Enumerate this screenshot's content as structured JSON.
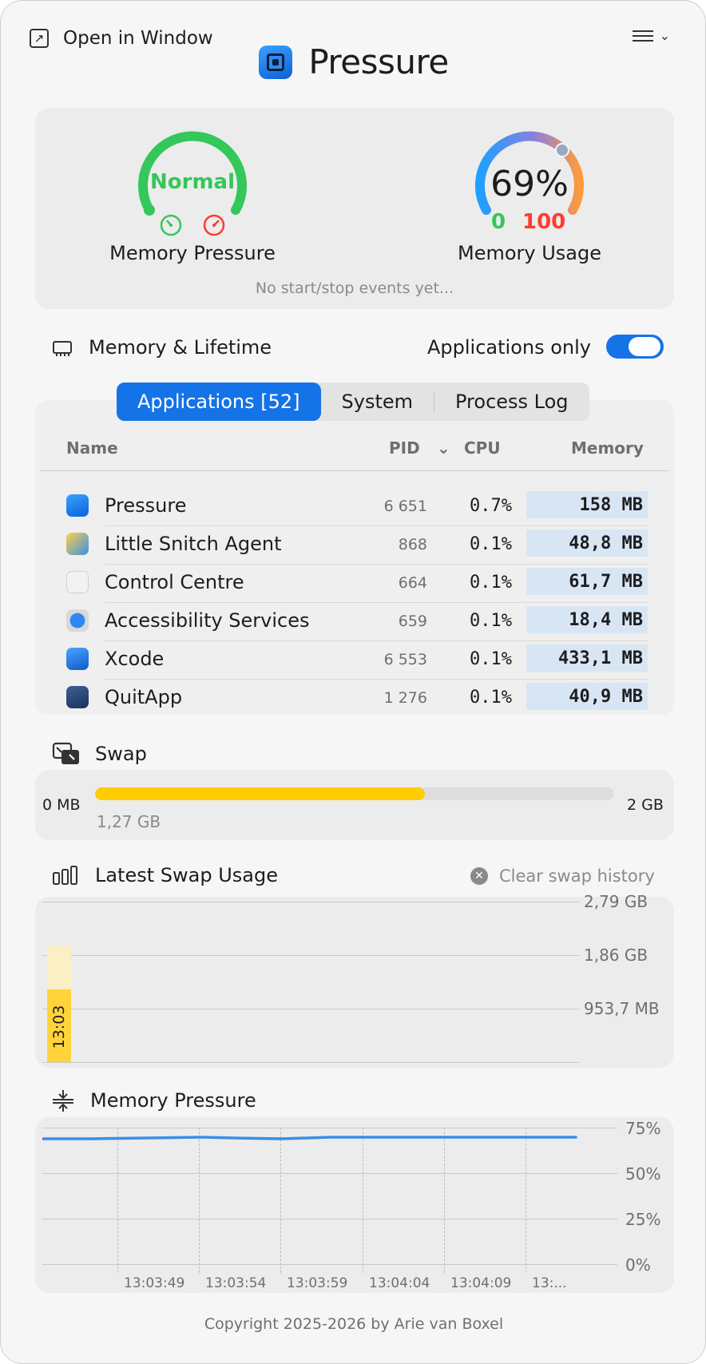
{
  "header": {
    "open_in_window": "Open in Window",
    "title": "Pressure",
    "open_icon": "arrow-up-right-square-icon",
    "menu_icon": "list-menu-icon"
  },
  "gauges": {
    "pressure": {
      "status": "Normal",
      "label": "Memory Pressure",
      "color": "#34c759"
    },
    "usage": {
      "value_text": "69%",
      "min": "0",
      "max": "100",
      "label": "Memory Usage",
      "percent": 69
    },
    "events_note": "No start/stop events yet..."
  },
  "memory_section": {
    "title": "Memory & Lifetime",
    "apps_only_label": "Applications only",
    "apps_only_on": true
  },
  "tabs": [
    {
      "label": "Applications [52]",
      "active": true
    },
    {
      "label": "System",
      "active": false
    },
    {
      "label": "Process Log",
      "active": false
    }
  ],
  "table": {
    "headers": {
      "name": "Name",
      "pid": "PID",
      "cpu": "CPU",
      "memory": "Memory"
    },
    "rows": [
      {
        "name": "Pressure",
        "pid": "6 651",
        "cpu": "0.7%",
        "memory": "158 MB",
        "icon": "pressure-app-icon",
        "color": "#1473e6"
      },
      {
        "name": "Little Snitch Agent",
        "pid": "868",
        "cpu": "0.1%",
        "memory": "48,8 MB",
        "icon": "little-snitch-icon",
        "color": "#f0a030"
      },
      {
        "name": "Control Centre",
        "pid": "664",
        "cpu": "0.1%",
        "memory": "61,7 MB",
        "icon": "control-centre-icon",
        "color": "#e8e8e8"
      },
      {
        "name": "Accessibility Services",
        "pid": "659",
        "cpu": "0.1%",
        "memory": "18,4 MB",
        "icon": "accessibility-icon",
        "color": "#2d87f0"
      },
      {
        "name": "Xcode",
        "pid": "6 553",
        "cpu": "0.1%",
        "memory": "433,1 MB",
        "icon": "xcode-icon",
        "color": "#1c7cf0"
      },
      {
        "name": "QuitApp",
        "pid": "1 276",
        "cpu": "0.1%",
        "memory": "40,9 MB",
        "icon": "quitapp-icon",
        "color": "#2b4a7a"
      }
    ]
  },
  "swap": {
    "title": "Swap",
    "min_label": "0 MB",
    "max_label": "2 GB",
    "used_label": "1,27 GB",
    "fraction": 0.635
  },
  "latest_swap": {
    "title": "Latest Swap Usage",
    "clear_label": "Clear swap history",
    "y_labels": [
      "2,79 GB",
      "1,86 GB",
      "953,7 MB"
    ],
    "bar_time": "13:03"
  },
  "memory_pressure": {
    "title": "Memory Pressure",
    "y_labels": [
      "75%",
      "50%",
      "25%",
      "0%"
    ],
    "x_labels": [
      "13:03:49",
      "13:03:54",
      "13:03:59",
      "13:04:04",
      "13:04:09",
      "13:..."
    ],
    "line_color": "#3a8ee6"
  },
  "footer": "Copyright 2025-2026 by Arie van Boxel"
}
